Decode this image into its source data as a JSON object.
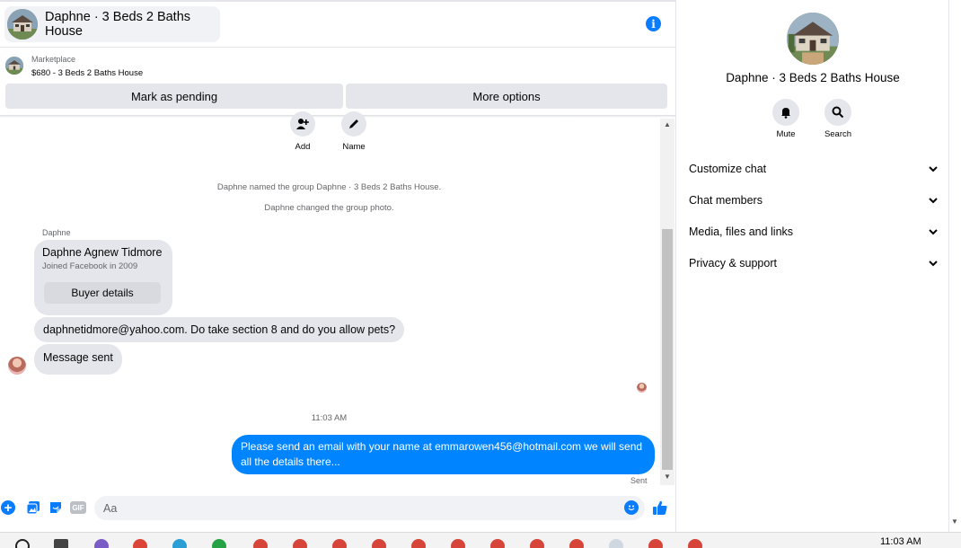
{
  "header": {
    "title": "Daphne · 3 Beds 2 Baths House"
  },
  "listing": {
    "source_label": "Marketplace",
    "item": "$680 - 3 Beds 2 Baths House"
  },
  "actions": {
    "pending_label": "Mark as pending",
    "options_label": "More options"
  },
  "group_actions": [
    {
      "label": "Add"
    },
    {
      "label": "Name"
    }
  ],
  "system_messages": [
    "Daphne named the group Daphne · 3 Beds 2 Baths House.",
    "Daphne changed the group photo."
  ],
  "incoming": {
    "sender": "Daphne",
    "card": {
      "name": "Daphne Agnew Tidmore",
      "joined": "Joined Facebook in 2009",
      "button_label": "Buyer details"
    },
    "messages": [
      "daphnetidmore@yahoo.com.  Do take section 8 and do you allow pets?",
      "Message sent"
    ]
  },
  "timestamp": "11:03 AM",
  "outgoing": {
    "line1": "Please send an email with your name at emmarowen456@hotmail.com we will send",
    "line2": "all the details there...",
    "status": "Sent"
  },
  "composer": {
    "placeholder": "Aa",
    "gif_label": "GIF"
  },
  "info_panel": {
    "title": "Daphne · 3 Beds 2 Baths House",
    "actions": [
      {
        "label": "Mute"
      },
      {
        "label": "Search"
      }
    ],
    "sections": [
      "Customize chat",
      "Chat members",
      "Media, files and links",
      "Privacy & support"
    ]
  },
  "taskbar": {
    "clock": "11:03 AM"
  },
  "colors": {
    "accent": "#0a7cff",
    "outgoing_bubble": "#0084ff",
    "incoming_bubble": "#e4e6eb"
  }
}
